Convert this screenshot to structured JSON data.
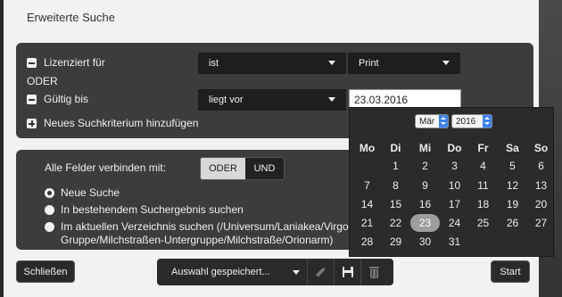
{
  "dialog": {
    "title": "Erweiterte Suche",
    "close_label": "Schließen",
    "start_label": "Start",
    "saved_selection_label": "Auswahl gespeichert...",
    "accent_color": "#3b82f6"
  },
  "criteria": {
    "row1": {
      "field": "Lizenziert für",
      "operator": "ist",
      "value": "Print"
    },
    "or_label": "ODER",
    "row2": {
      "field": "Gültig bis",
      "operator": "liegt vor",
      "value": "23.03.2016"
    },
    "add_label": "Neues Suchkriterium hinzufügen"
  },
  "options": {
    "connect_label": "Alle Felder verbinden mit:",
    "connect_or": "ODER",
    "connect_and": "UND",
    "radio_new": "Neue Suche",
    "radio_existing": "In bestehendem Suchergebnis suchen",
    "radio_folder_line1": "Im aktuellen Verzeichnis suchen (/Universum/Laniakea/Virgo-Superhaufen/Lokale",
    "radio_folder_line2": "Gruppe/Milchstraßen-Untergruppe/Milchstraße/Orionarm)"
  },
  "calendar": {
    "month": "Mär",
    "year": "2016",
    "weekdays": [
      "Mo",
      "Di",
      "Mi",
      "Do",
      "Fr",
      "Sa",
      "So"
    ],
    "weeks": [
      [
        "",
        "1",
        "2",
        "3",
        "4",
        "5",
        "6"
      ],
      [
        "7",
        "8",
        "9",
        "10",
        "11",
        "12",
        "13"
      ],
      [
        "14",
        "15",
        "16",
        "17",
        "18",
        "19",
        "20"
      ],
      [
        "21",
        "22",
        "23",
        "24",
        "25",
        "26",
        "27"
      ],
      [
        "28",
        "29",
        "30",
        "31",
        "",
        "",
        ""
      ]
    ],
    "selected_day": "23"
  },
  "icons": {
    "pencil": "pencil-icon",
    "save": "save-icon",
    "trash": "trash-icon"
  }
}
